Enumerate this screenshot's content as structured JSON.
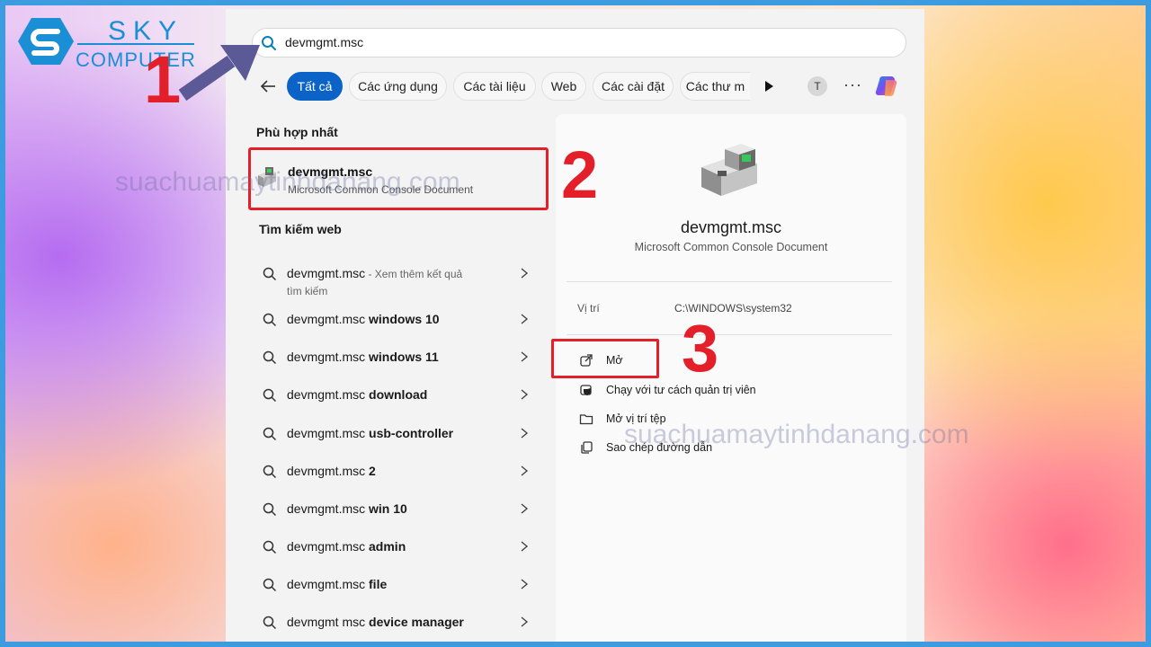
{
  "brand": {
    "logo_line1": "SKY",
    "logo_line2": "COMPUTER",
    "watermark": "suachuamaytinhdanang.com"
  },
  "annotations": {
    "step1": "1",
    "step2": "2",
    "step3": "3"
  },
  "search": {
    "query": "devmgmt.msc"
  },
  "filters": {
    "items": [
      {
        "label": "Tất cả",
        "active": true
      },
      {
        "label": "Các ứng dụng",
        "active": false
      },
      {
        "label": "Các tài liệu",
        "active": false
      },
      {
        "label": "Web",
        "active": false
      },
      {
        "label": "Các cài đặt",
        "active": false
      },
      {
        "label": "Các thư m",
        "active": false
      }
    ],
    "avatar_letter": "T",
    "more_label": "···"
  },
  "best_match": {
    "section_title": "Phù hợp nhất",
    "name": "devmgmt.msc",
    "type": "Microsoft Common Console Document"
  },
  "web_search": {
    "section_title": "Tìm kiếm web",
    "first": {
      "query": "devmgmt.msc",
      "suffix": " - Xem thêm kết quả",
      "line2": "tìm kiếm"
    },
    "items": [
      {
        "prefix": "devmgmt.msc ",
        "suffix": "windows 10"
      },
      {
        "prefix": "devmgmt.msc ",
        "suffix": "windows 11"
      },
      {
        "prefix": "devmgmt.msc ",
        "suffix": "download"
      },
      {
        "prefix": "devmgmt.msc ",
        "suffix": "usb-controller"
      },
      {
        "prefix": "devmgmt.msc ",
        "suffix": "2"
      },
      {
        "prefix": "devmgmt.msc ",
        "suffix": "win 10"
      },
      {
        "prefix": "devmgmt.msc ",
        "suffix": "admin"
      },
      {
        "prefix": "devmgmt.msc ",
        "suffix": "file"
      },
      {
        "prefix": "devmgmt msc ",
        "suffix": "device manager"
      }
    ]
  },
  "details": {
    "title": "devmgmt.msc",
    "subtitle": "Microsoft Common Console Document",
    "location_label": "Vị trí",
    "location_value": "C:\\WINDOWS\\system32",
    "actions": [
      {
        "label": "Mở",
        "icon": "open-external-icon"
      },
      {
        "label": "Chạy với tư cách quản trị viên",
        "icon": "shield-admin-icon"
      },
      {
        "label": "Mở vị trí tệp",
        "icon": "folder-icon"
      },
      {
        "label": "Sao chép đường dẫn",
        "icon": "copy-icon"
      }
    ]
  },
  "colors": {
    "accent": "#0b63c8",
    "highlight": "#e3202a",
    "arrow": "#5b5a96"
  }
}
